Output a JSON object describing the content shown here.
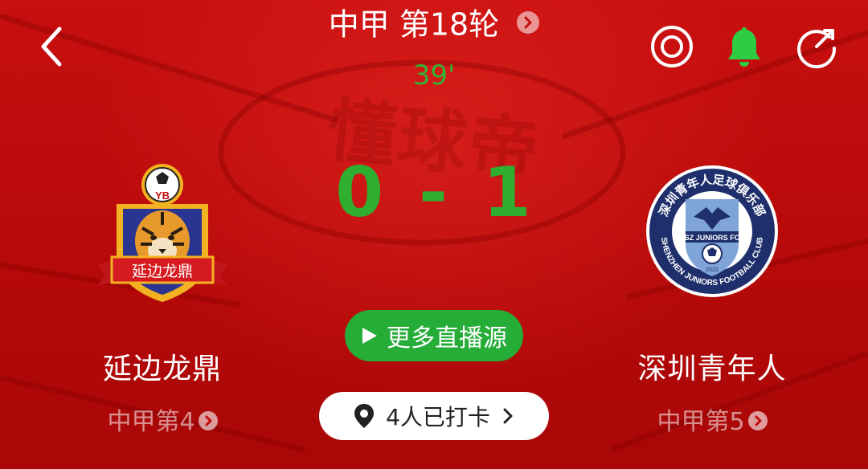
{
  "header": {
    "title": "中甲 第18轮",
    "minute": "39'",
    "icons": [
      "back-icon",
      "target-icon",
      "bell-icon",
      "share-icon"
    ]
  },
  "watermark": "懂球帝",
  "score": {
    "home": "0",
    "separator": "-",
    "away": "1"
  },
  "home_team": {
    "name": "延边龙鼎",
    "rank": "中甲第4",
    "crest": {
      "top_badge": "YB",
      "ribbon": "延边龙鼎"
    }
  },
  "away_team": {
    "name": "深圳青年人",
    "rank": "中甲第5",
    "crest": {
      "top_arc": "深圳青年人足球俱乐部",
      "left_arc": "SHENZHEN JUNIORS FOOTBALL CLUB",
      "shield_text": "SZ JUNIORS FC",
      "year": "2022"
    }
  },
  "live_button": {
    "label": "更多直播源"
  },
  "checkin": {
    "label": "4人已打卡"
  },
  "colors": {
    "bg": "#c20c0c",
    "score_green": "#2fae2f",
    "button_green": "#26ad38",
    "bell_green": "#2ecc40"
  }
}
